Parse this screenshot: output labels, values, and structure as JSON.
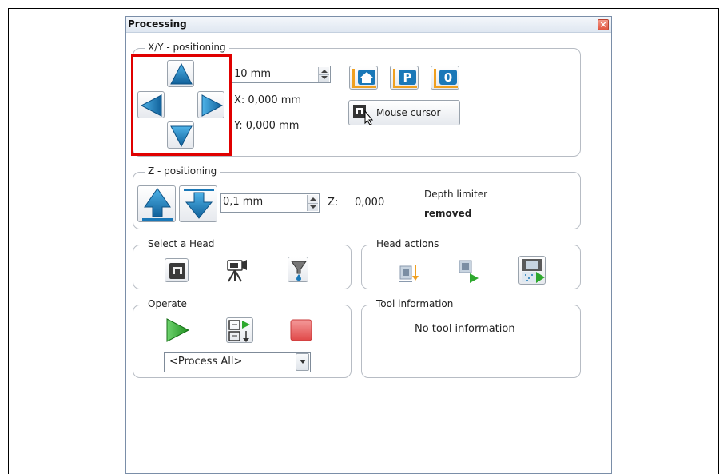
{
  "window": {
    "title": "Processing",
    "close_symbol": "×"
  },
  "xy": {
    "legend": "X/Y - positioning",
    "step_value": "10 mm",
    "x_readout": "X:  0,000 mm",
    "y_readout": "Y:  0,000 mm",
    "mouse_cursor_label": "Mouse cursor",
    "home_icon_glyph": "⌂",
    "park_icon_glyph": "P",
    "zero_icon_glyph": "0"
  },
  "z": {
    "legend": "Z - positioning",
    "step_value": "0,1 mm",
    "z_label": "Z:",
    "z_value": "0,000",
    "depth_limiter_label": "Depth limiter",
    "depth_limiter_state": "removed"
  },
  "select_head": {
    "legend": "Select a Head"
  },
  "head_actions": {
    "legend": "Head actions"
  },
  "operate": {
    "legend": "Operate",
    "process_selection": "<Process All>"
  },
  "tool_info": {
    "legend": "Tool information",
    "message": "No tool information"
  },
  "colors": {
    "arrow_blue": "#1a78b8",
    "highlight_red": "#e00000",
    "accent_orange": "#f0a020",
    "play_green": "#2ea82e",
    "stop_red": "#e84848"
  }
}
